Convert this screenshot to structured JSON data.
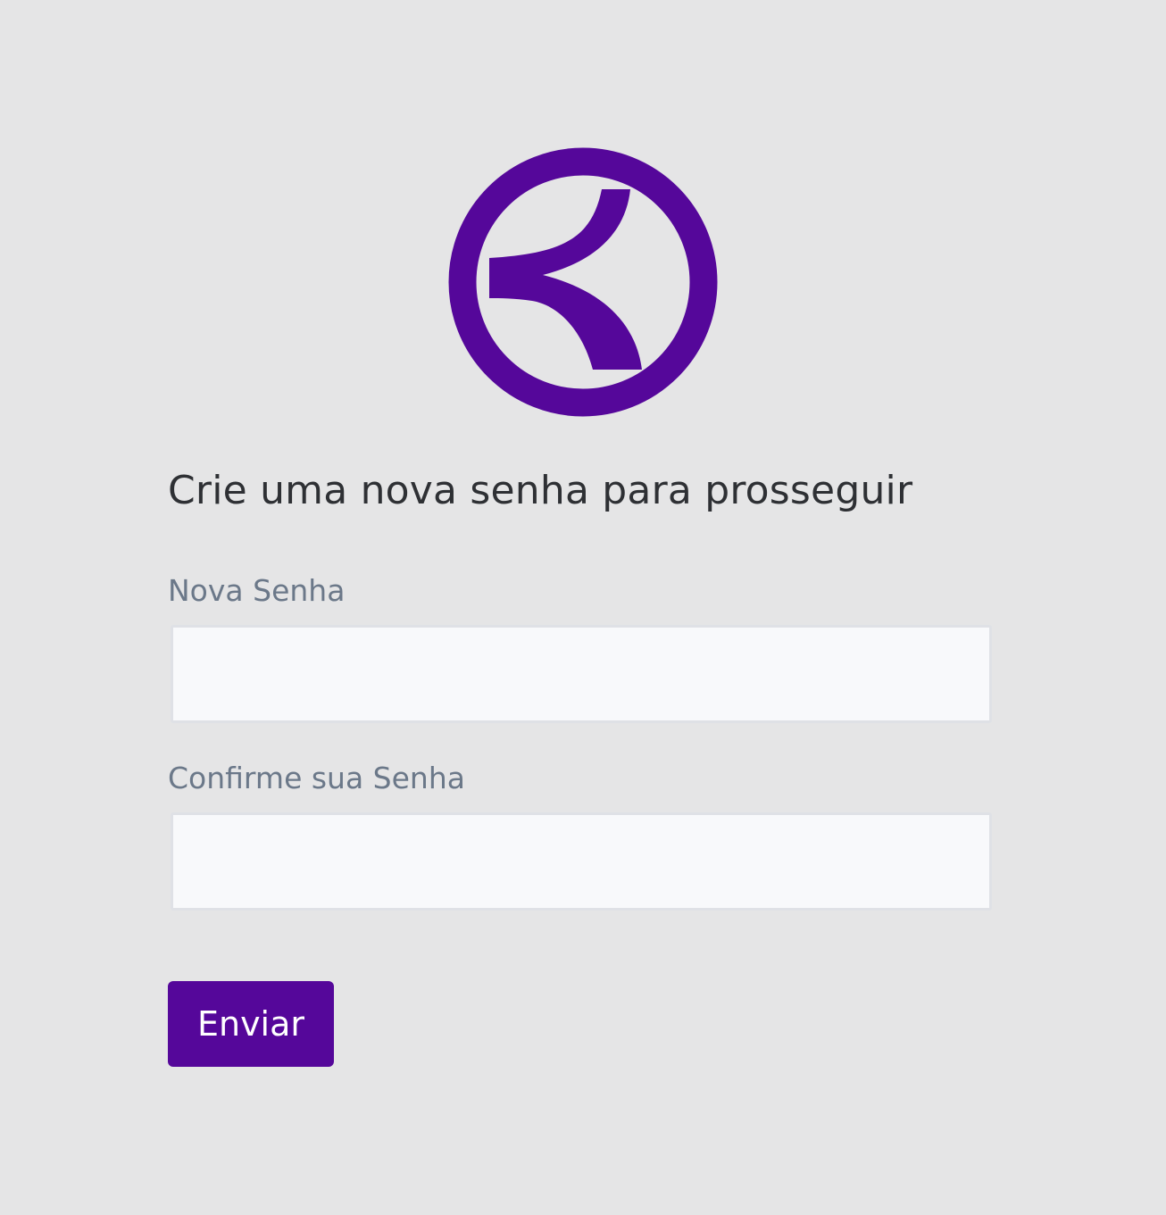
{
  "brand": {
    "logo_icon": "circled-arrow-logo-icon",
    "color": "#55079a"
  },
  "form": {
    "title": "Crie uma nova senha para prosseguir",
    "new_password": {
      "label": "Nova Senha",
      "value": "",
      "placeholder": ""
    },
    "confirm_password": {
      "label": "Confirme sua Senha",
      "value": "",
      "placeholder": ""
    },
    "submit_label": "Enviar"
  },
  "colors": {
    "background": "#e5e5e6",
    "title_text": "#2e3034",
    "label_text": "#6b7889",
    "input_background": "#f8f9fb",
    "button_background": "#55079a",
    "button_text": "#ffffff"
  }
}
